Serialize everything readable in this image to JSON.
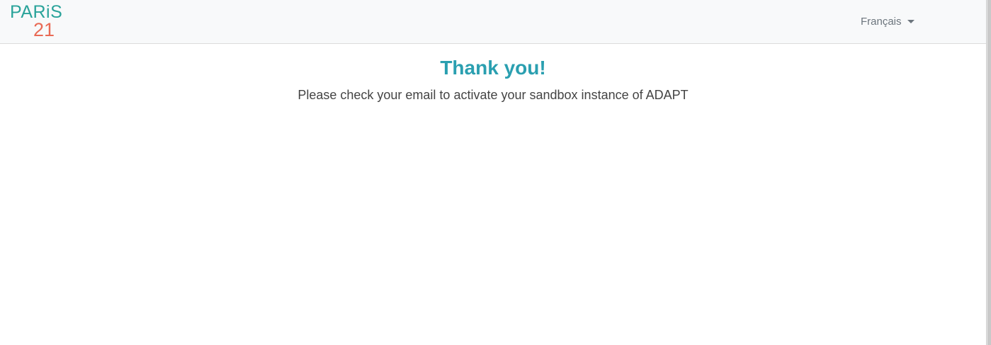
{
  "brand": {
    "logo_line1": "PARiS",
    "logo_line2": "21",
    "primary_color": "#2aa39a",
    "accent_color": "#e96a55"
  },
  "navbar": {
    "language_label": "Français",
    "language_icon": "caret-down-icon"
  },
  "main": {
    "title": "Thank you!",
    "message": "Please check your email to activate your sandbox instance of ADAPT",
    "title_color": "#2a9fb0"
  }
}
